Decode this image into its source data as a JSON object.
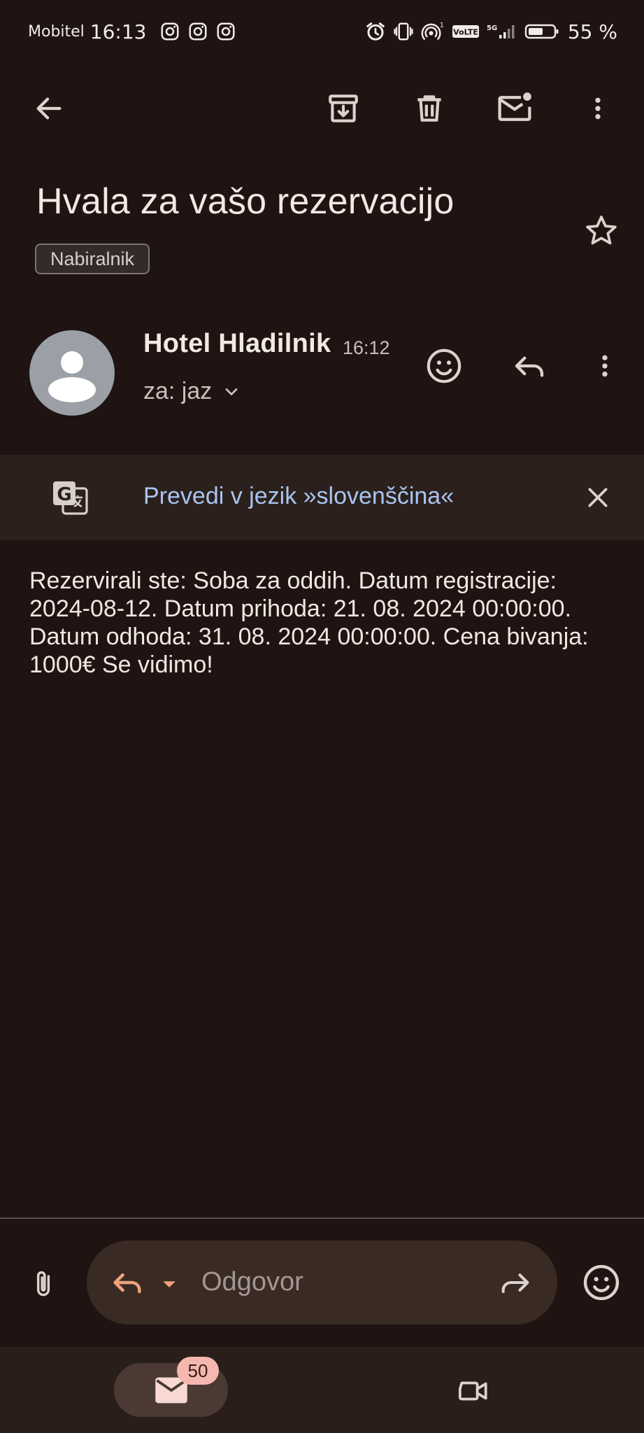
{
  "status_bar": {
    "carrier": "Mobitel",
    "time": "16:13",
    "battery": "55 %",
    "signal_superscript": "1",
    "network_label": "5G",
    "volte_label": "VoLTE",
    "icons": [
      "instagram-icon",
      "instagram-icon",
      "instagram-icon",
      "alarm-icon",
      "vibrate-icon",
      "hotspot-icon",
      "volte-icon",
      "signal-icon",
      "battery-icon"
    ]
  },
  "toolbar": {
    "icons": [
      "back-arrow-icon",
      "archive-icon",
      "delete-icon",
      "mark-unread-icon",
      "more-vert-icon"
    ]
  },
  "email": {
    "subject": "Hvala za vašo rezervacijo",
    "label": "Nabiralnik",
    "sender_name": "Hotel Hladilnik",
    "time": "16:12",
    "recipient": "za: jaz",
    "body": "Rezervirali ste: Soba za oddih. Datum registracije: 2024-08-12. Datum prihoda: 21. 08. 2024 00:00:00. Datum odhoda: 31. 08. 2024 00:00:00. Cena bivanja: 1000€ Se vidimo!"
  },
  "translate": {
    "text": "Prevedi v jezik »slovenščina«"
  },
  "reply_bar": {
    "placeholder": "Odgovor"
  },
  "bottom_nav": {
    "mail_badge": "50"
  },
  "colors": {
    "background": "#1f1412",
    "translate_link": "#a8c4f2",
    "reply_accent": "#f0a27a",
    "badge": "#f4b8b0"
  }
}
